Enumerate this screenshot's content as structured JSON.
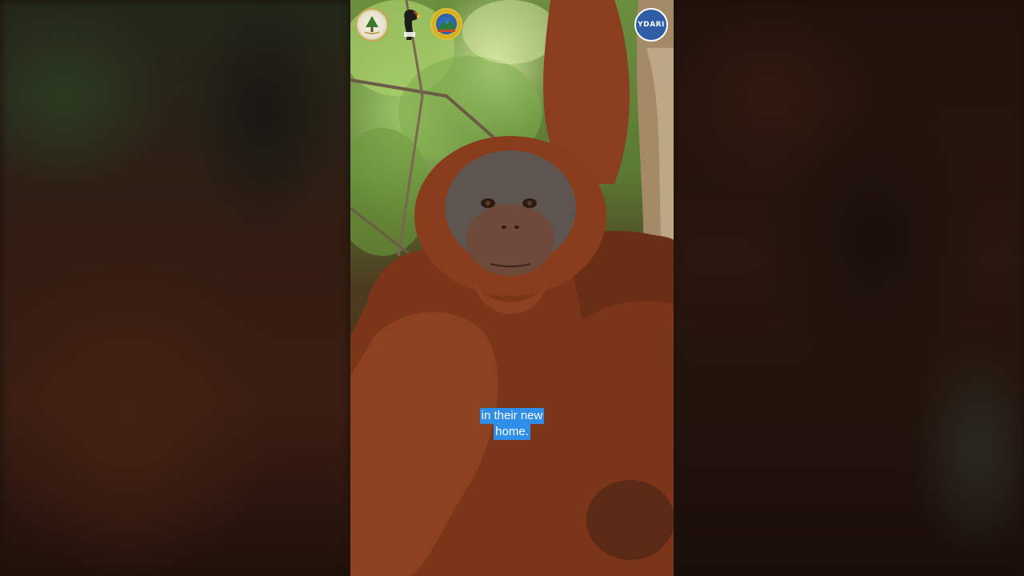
{
  "caption": {
    "line1": "in their new",
    "line2": "home."
  },
  "logos": [
    {
      "icon": "forest-emblem-icon"
    },
    {
      "icon": "hornbill-icon"
    },
    {
      "icon": "mountain-emblem-icon"
    },
    {
      "icon": "ydari-logo-icon",
      "text": "YDARI"
    }
  ],
  "colors": {
    "caption_background": "#2f8fe8",
    "caption_text": "#ffffff"
  }
}
